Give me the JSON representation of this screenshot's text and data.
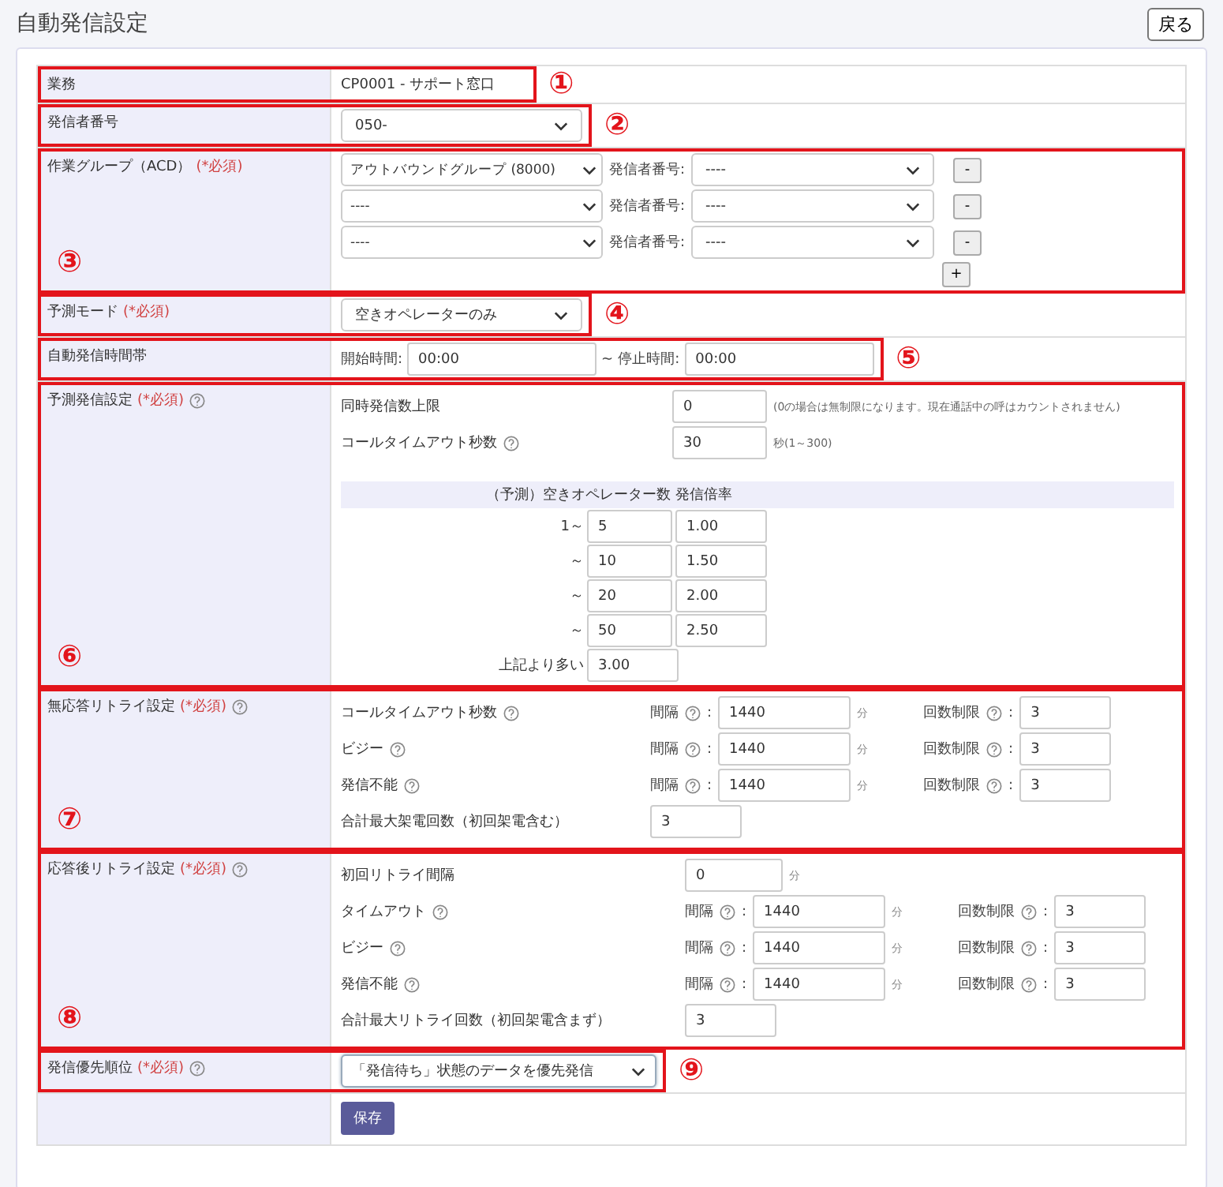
{
  "page_title": "自動発信設定",
  "back_button": "戻る",
  "rows": [
    {
      "kind": "text",
      "label": "業務",
      "value": "CP0001 - サポート窓口",
      "annotation": "①"
    },
    {
      "kind": "select",
      "label": "発信者番号",
      "value": "050-",
      "annotation": "②"
    },
    {
      "kind": "groups",
      "label": "作業グループ（ACD）",
      "required": "(*必須)",
      "groups": [
        {
          "group": "アウトバウンドグループ (8000)",
          "caller_label": "発信者番号:",
          "caller": "----",
          "remove": "-"
        },
        {
          "group": "----",
          "caller_label": "発信者番号:",
          "caller": "----",
          "remove": "-"
        },
        {
          "group": "----",
          "caller_label": "発信者番号:",
          "caller": "----",
          "remove": "-"
        }
      ],
      "add": "+",
      "annotation": "③"
    },
    {
      "kind": "select",
      "label": "予測モード",
      "required": "(*必須)",
      "value": "空きオペレーターのみ",
      "annotation": "④"
    },
    {
      "kind": "timerange",
      "label": "自動発信時間帯",
      "start_label": "開始時間:",
      "start": "00:00",
      "separator": "~",
      "stop_label": "停止時間:",
      "stop": "00:00",
      "annotation": "⑤"
    },
    {
      "kind": "predictive",
      "label": "予測発信設定",
      "required": "(*必須)",
      "help": true,
      "fields": [
        {
          "label": "同時発信数上限",
          "help": false,
          "value": "0",
          "note": "(0の場合は無制限になります。現在通話中の呼はカウントされません)"
        },
        {
          "label": "コールタイムアウト秒数",
          "help": true,
          "value": "30",
          "note": "秒(1～300)"
        }
      ],
      "rate_table": {
        "header": "（予測）空きオペレーター数 発信倍率",
        "rows": [
          {
            "prefix": "1～",
            "operators": "5",
            "rate": "1.00"
          },
          {
            "prefix": "～",
            "operators": "10",
            "rate": "1.50"
          },
          {
            "prefix": "～",
            "operators": "20",
            "rate": "2.00"
          },
          {
            "prefix": "～",
            "operators": "50",
            "rate": "2.50"
          },
          {
            "prefix": "上記より多い",
            "rate": "3.00"
          }
        ]
      },
      "annotation": "⑥"
    },
    {
      "kind": "retry",
      "label": "無応答リトライ設定",
      "required": "(*必須)",
      "help": true,
      "items": [
        {
          "label": "コールタイムアウト秒数",
          "help": true,
          "interval_label": "間隔",
          "interval_sep": ":",
          "interval": "1440",
          "unit": "分",
          "limit_label": "回数制限",
          "limit_sep": ":",
          "limit": "3"
        },
        {
          "label": "ビジー",
          "help": true,
          "interval_label": "間隔",
          "interval_sep": ":",
          "interval": "1440",
          "unit": "分",
          "limit_label": "回数制限",
          "limit_sep": ":",
          "limit": "3"
        },
        {
          "label": "発信不能",
          "help": true,
          "interval_label": "間隔",
          "interval_sep": ":",
          "interval": "1440",
          "unit": "分",
          "limit_label": "回数制限",
          "limit_sep": ":",
          "limit": "3"
        }
      ],
      "total": {
        "label": "合計最大架電回数（初回架電含む）",
        "value": "3"
      },
      "annotation": "⑦"
    },
    {
      "kind": "retry",
      "label": "応答後リトライ設定",
      "required": "(*必須)",
      "help": true,
      "initial": {
        "label": "初回リトライ間隔",
        "value": "0",
        "unit": "分"
      },
      "items": [
        {
          "label": "タイムアウト",
          "help": true,
          "interval_label": "間隔",
          "interval_sep": ":",
          "interval": "1440",
          "unit": "分",
          "limit_label": "回数制限",
          "limit_sep": ":",
          "limit": "3"
        },
        {
          "label": "ビジー",
          "help": true,
          "interval_label": "間隔",
          "interval_sep": ":",
          "interval": "1440",
          "unit": "分",
          "limit_label": "回数制限",
          "limit_sep": ":",
          "limit": "3"
        },
        {
          "label": "発信不能",
          "help": true,
          "interval_label": "間隔",
          "interval_sep": ":",
          "interval": "1440",
          "unit": "分",
          "limit_label": "回数制限",
          "limit_sep": ":",
          "limit": "3"
        }
      ],
      "total": {
        "label": "合計最大リトライ回数（初回架電含まず）",
        "value": "3"
      },
      "annotation": "⑧"
    },
    {
      "kind": "select",
      "label": "発信優先順位",
      "required": "(*必須)",
      "help": true,
      "value": "「発信待ち」状態のデータを優先発信",
      "annotation": "⑨"
    },
    {
      "kind": "submit",
      "button": "保存"
    }
  ]
}
